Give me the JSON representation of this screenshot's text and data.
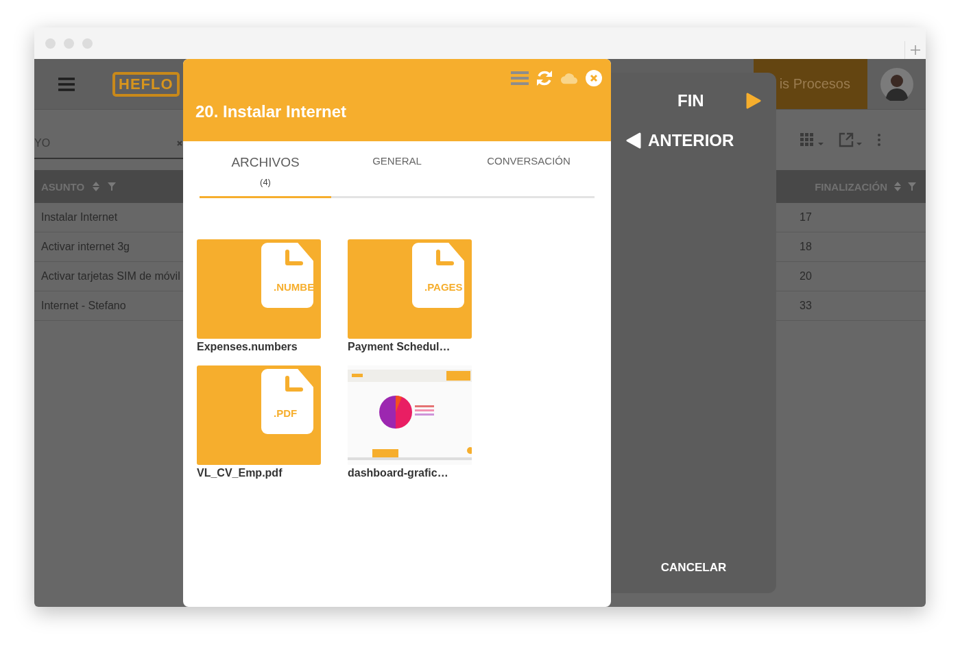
{
  "app": {
    "logo": "HEFLO",
    "nav_tab": "is Procesos",
    "search": {
      "value": "YO"
    },
    "table": {
      "columns": [
        "ASUNTO",
        "FINALIZACIÓN"
      ],
      "rows": [
        {
          "subject": "Instalar Internet",
          "end": "17"
        },
        {
          "subject": "Activar internet 3g",
          "end": "18"
        },
        {
          "subject": "Activar tarjetas SIM de móvil",
          "end": "20"
        },
        {
          "subject": "Internet - Stefano",
          "end": "33"
        }
      ]
    }
  },
  "task": {
    "title": "20. Instalar Internet",
    "tabs": [
      {
        "label": "ARCHIVOS",
        "count": "(4)",
        "selected": true
      },
      {
        "label": "GENERAL",
        "selected": false
      },
      {
        "label": "CONVERSACIÓN",
        "selected": false
      }
    ],
    "files": [
      {
        "kind": "document",
        "extension": ".NUMBE",
        "name": "Expenses.numbers"
      },
      {
        "kind": "document",
        "extension": ".PAGES",
        "name": "Payment Schedul…"
      },
      {
        "kind": "document",
        "extension": ".PDF",
        "name": "VL_CV_Emp.pdf"
      },
      {
        "kind": "picture",
        "name": "dashboard-grafic…"
      }
    ]
  },
  "actions": {
    "next": "FIN",
    "previous": "ANTERIOR",
    "cancel": "CANCELAR"
  }
}
